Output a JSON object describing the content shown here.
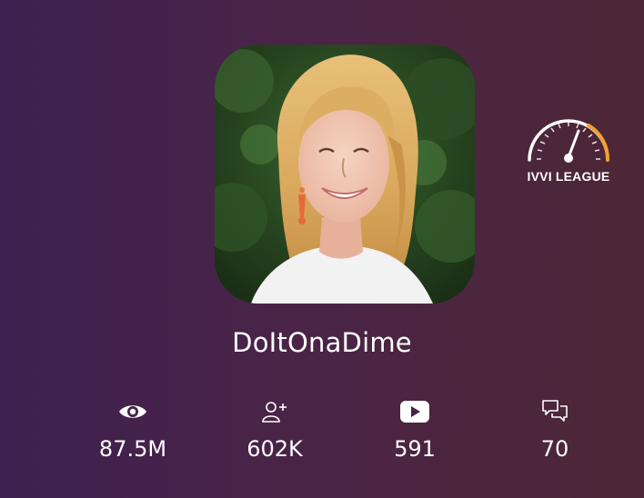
{
  "profile": {
    "username": "DoItOnaDime",
    "avatar_description": "woman-with-blonde-hair-smiling"
  },
  "league_badge": {
    "label": "IVVI LEAGUE",
    "icon": "speedometer-icon",
    "accent_color": "#f0a030"
  },
  "stats": [
    {
      "name": "views",
      "icon": "eye-icon",
      "value": "87.5M"
    },
    {
      "name": "subscribers",
      "icon": "add-user-icon",
      "value": "602K"
    },
    {
      "name": "videos",
      "icon": "play-icon",
      "value": "591"
    },
    {
      "name": "comments",
      "icon": "chat-icon",
      "value": "70"
    }
  ],
  "colors": {
    "background_left": "#3d2150",
    "background_right": "#4d2735",
    "text": "#ffffff"
  }
}
